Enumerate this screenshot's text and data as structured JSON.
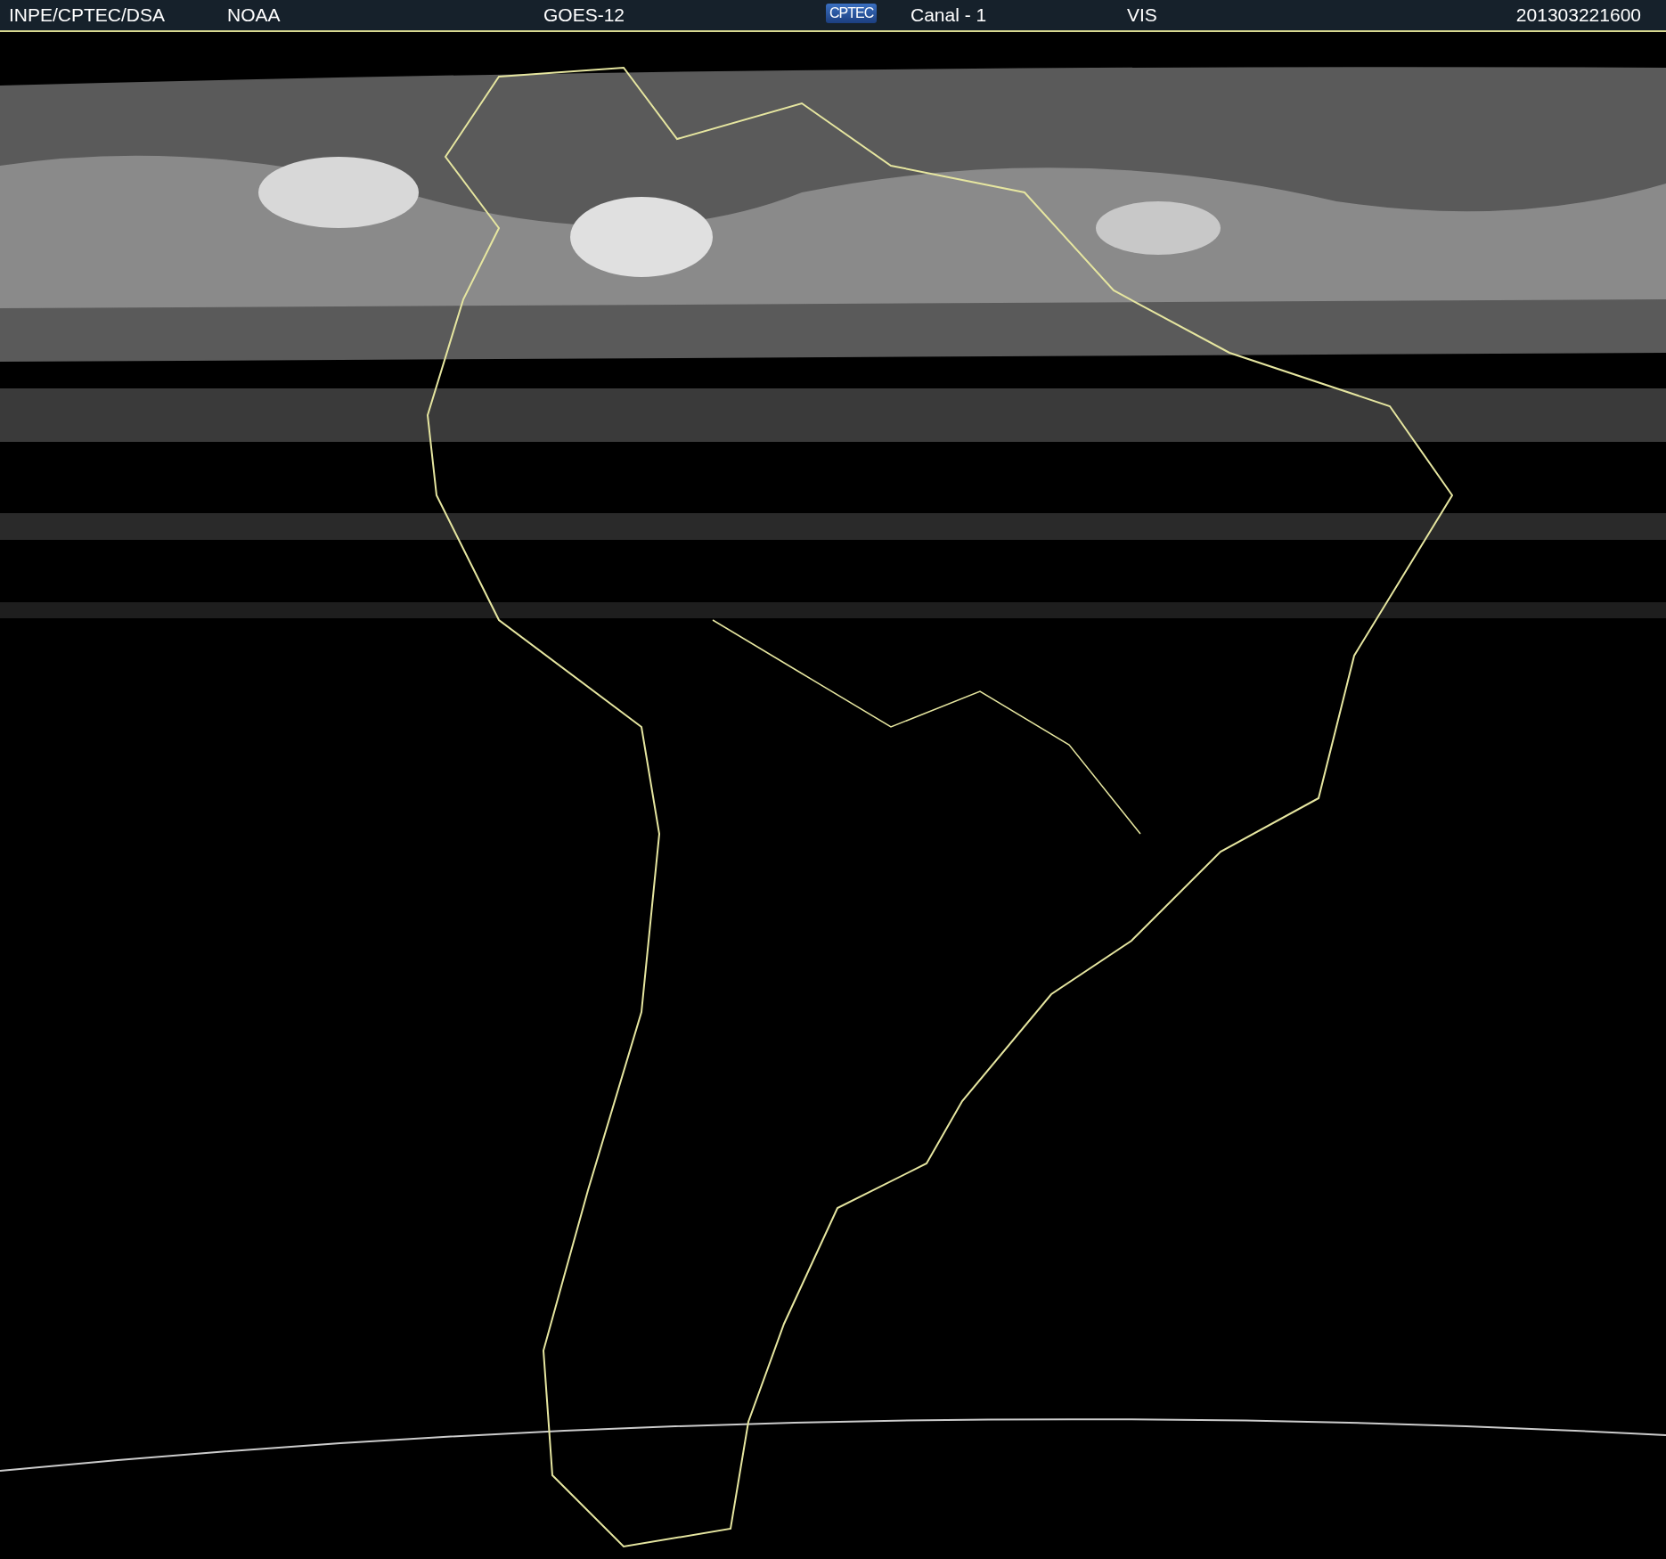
{
  "header": {
    "source": "INPE/CPTEC/DSA",
    "agency": "NOAA",
    "satellite": "GOES-12",
    "logo": "CPTEC",
    "channel": "Canal - 1",
    "band": "VIS",
    "timestamp": "201303221600"
  }
}
